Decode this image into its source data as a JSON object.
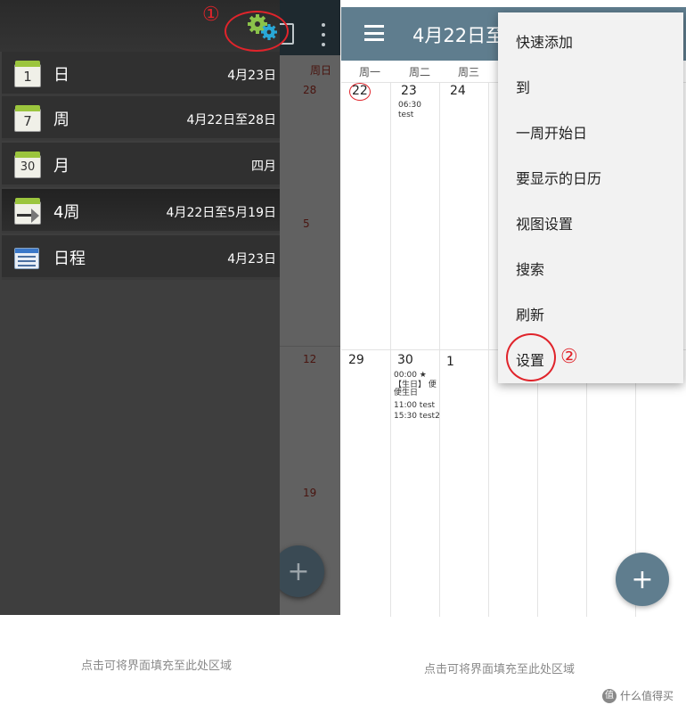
{
  "left": {
    "marker": "①",
    "background_calendar": {
      "weekday": "周日",
      "dates": [
        "28",
        "5",
        "12",
        "19"
      ]
    },
    "drawer_items": [
      {
        "icon_num": "1",
        "label": "日",
        "range": "4月23日"
      },
      {
        "icon_num": "7",
        "label": "周",
        "range": "4月22日至28日"
      },
      {
        "icon_num": "30",
        "label": "月",
        "range": "四月"
      },
      {
        "icon_num": "",
        "label": "4周",
        "range": "4月22日至5月19日"
      },
      {
        "icon_num": "",
        "label": "日程",
        "range": "4月23日"
      }
    ],
    "fab": "+",
    "fill_hint": "点击可将界面填充至此处区域"
  },
  "right": {
    "title": "4月22日至",
    "weekdays": [
      "周一",
      "周二",
      "周三"
    ],
    "week1": {
      "days": [
        "22",
        "23",
        "24"
      ],
      "events": [
        "06:30 test"
      ]
    },
    "week2": {
      "days": [
        "29",
        "30",
        "1"
      ],
      "events": [
        "00:00 ★【生日】 便",
        "便生日",
        "11:00 test",
        "15:30 test2"
      ]
    },
    "menu": [
      "快速添加",
      "到",
      "一周开始日",
      "要显示的日历",
      "视图设置",
      "搜索",
      "刷新",
      "设置"
    ],
    "marker": "②",
    "fab": "+",
    "fill_hint": "点击可将界面填充至此处区域"
  },
  "watermark": {
    "logo": "值",
    "text": "什么值得买"
  }
}
